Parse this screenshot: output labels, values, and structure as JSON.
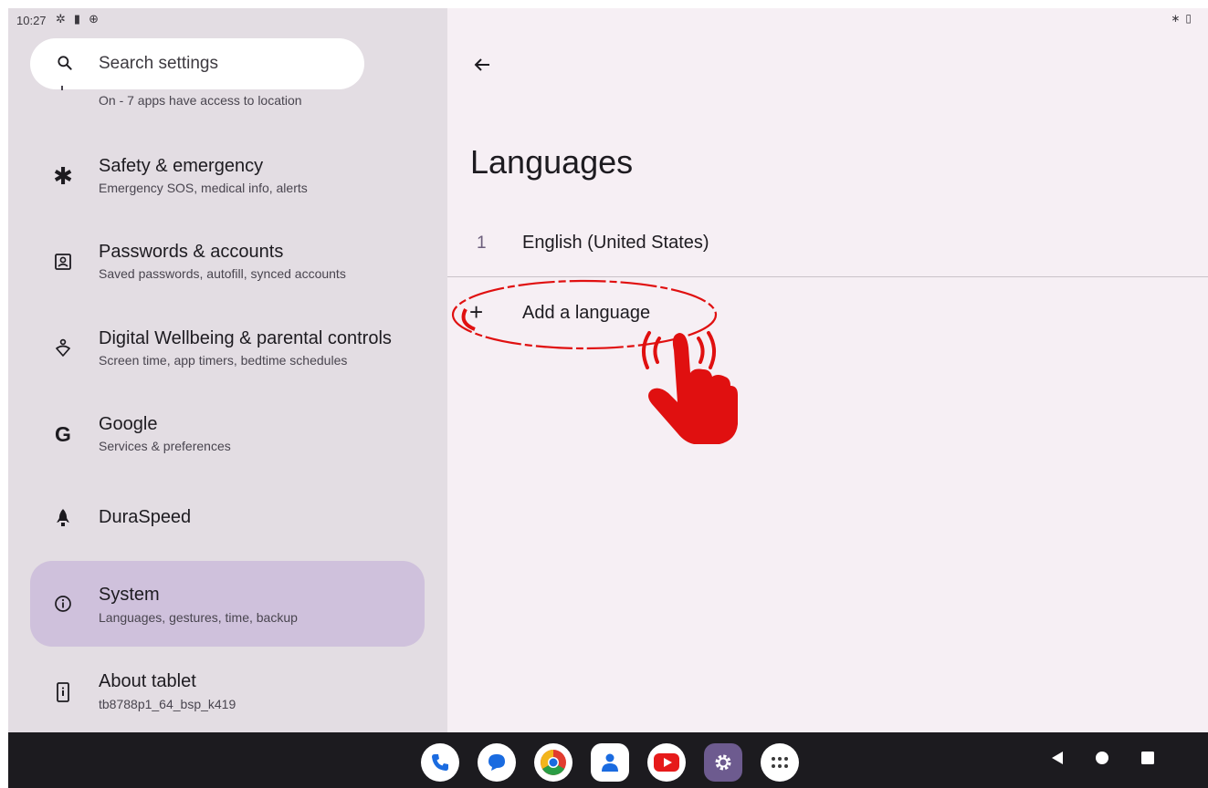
{
  "status_bar": {
    "time": "10:27",
    "left_icons": [
      "settings-gear-icon",
      "sim-card-icon",
      "vpn-icon"
    ],
    "right_icons": [
      "bluetooth-icon",
      "battery-icon"
    ]
  },
  "search": {
    "placeholder": "Search settings"
  },
  "sidebar": {
    "location_subtitle": "On - 7 apps have access to location",
    "items": [
      {
        "title": "Safety & emergency",
        "subtitle": "Emergency SOS, medical info, alerts",
        "icon": "asterisk-icon"
      },
      {
        "title": "Passwords & accounts",
        "subtitle": "Saved passwords, autofill, synced accounts",
        "icon": "account-box-icon"
      },
      {
        "title": "Digital Wellbeing & parental controls",
        "subtitle": "Screen time, app timers, bedtime schedules",
        "icon": "wellbeing-icon"
      },
      {
        "title": "Google",
        "subtitle": "Services & preferences",
        "icon": "google-g-icon"
      },
      {
        "title": "DuraSpeed",
        "subtitle": "",
        "icon": "rocket-icon"
      },
      {
        "title": "System",
        "subtitle": "Languages, gestures, time, backup",
        "icon": "info-icon",
        "active": true
      },
      {
        "title": "About tablet",
        "subtitle": "tb8788p1_64_bsp_k419",
        "icon": "tablet-icon"
      }
    ]
  },
  "detail": {
    "title": "Languages",
    "languages": [
      {
        "index": "1",
        "name": "English (United States)"
      }
    ],
    "add_label": "Add a language"
  },
  "taskbar": {
    "apps": [
      "phone",
      "messages",
      "chrome",
      "contacts",
      "youtube",
      "settings",
      "app-drawer"
    ],
    "nav": [
      "back",
      "home",
      "recents"
    ]
  },
  "colors": {
    "sidebar_bg": "#e3dde3",
    "detail_bg": "#f6eff4",
    "active_item": "#cfc1dc",
    "annotation_red": "#e01010"
  }
}
